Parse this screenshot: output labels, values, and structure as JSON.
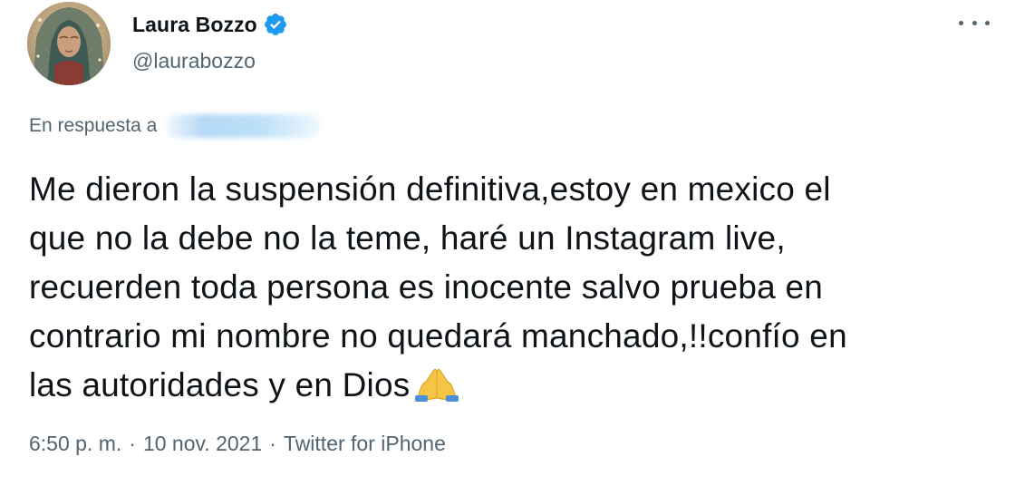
{
  "author": {
    "display_name": "Laura Bozzo",
    "handle": "@laurabozzo",
    "verified": true,
    "avatar_icon": "avatar-image"
  },
  "reply": {
    "prefix": "En respuesta a"
  },
  "tweet": {
    "lines": [
      "Me dieron la suspensión definitiva,estoy en mexico el",
      "que no la debe no la teme, haré un Instagram live,",
      "recuerden toda persona es inocente salvo prueba en",
      "contrario mi nombre no quedará manchado,!!confío en",
      "las autoridades y en Dios"
    ],
    "emoji": "folded-hands"
  },
  "meta": {
    "time": "6:50 p. m.",
    "separator": "·",
    "date": "10 nov. 2021",
    "source": "Twitter for iPhone"
  },
  "colors": {
    "text_primary": "#0f1419",
    "text_secondary": "#536471",
    "verified_badge": "#1d9bf0"
  }
}
